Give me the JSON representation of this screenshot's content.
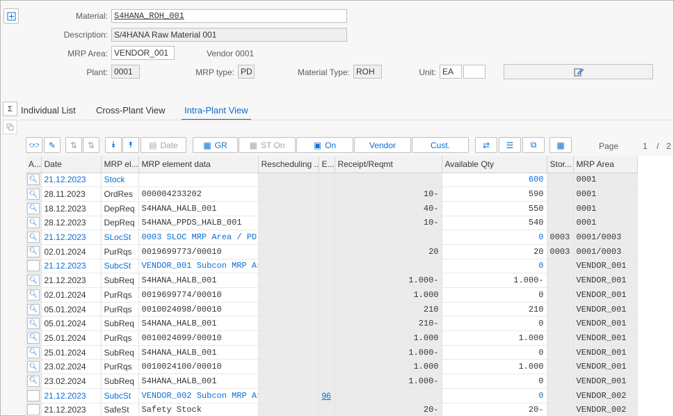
{
  "header": {
    "material_label": "Material:",
    "material_value": "S4HANA_ROH_001",
    "description_label": "Description:",
    "description_value": "S/4HANA Raw Material 001",
    "mrp_area_label": "MRP Area:",
    "mrp_area_value": "VENDOR_001",
    "vendor_text": "Vendor 0001",
    "plant_label": "Plant:",
    "plant_value": "0001",
    "mrp_type_label": "MRP type:",
    "mrp_type_value": "PD",
    "material_type_label": "Material Type:",
    "material_type_value": "ROH",
    "unit_label": "Unit:",
    "unit_value": "EA",
    "unit_extra_value": ""
  },
  "tabs": [
    {
      "label": "Individual List"
    },
    {
      "label": "Cross-Plant View"
    },
    {
      "label": "Intra-Plant View"
    }
  ],
  "side": {
    "sigma": "Σ"
  },
  "toolbar": {
    "date_label": "Date",
    "gr_label": "GR",
    "st_on_label": "ST On",
    "on_label": "On",
    "vendor_label": "Vendor",
    "cust_label": "Cust.",
    "page_label": "Page",
    "page_current": "1",
    "page_sep": "/",
    "page_total": "2"
  },
  "colors": {
    "accent": "#0a6ed1",
    "header_bg": "#f7f7f7",
    "cell_grey": "#ebebeb"
  },
  "table": {
    "columns": [
      "A...",
      "Date",
      "MRP el...",
      "MRP element data",
      "Rescheduling ...",
      "E...",
      "Receipt/Reqmt",
      "Available Qty",
      "Stor...",
      "MRP Area"
    ],
    "rows": [
      {
        "zoom": true,
        "date": "21.12.2023",
        "mrp_el": "Stock",
        "data": "",
        "resched": "",
        "e": "",
        "receipt": "",
        "avail": "600",
        "stor": "",
        "area": "0001",
        "blue": true
      },
      {
        "zoom": true,
        "date": "28.11.2023",
        "mrp_el": "OrdRes",
        "data": "000004233202",
        "resched": "",
        "e": "",
        "receipt": "10-",
        "avail": "590",
        "stor": "",
        "area": "0001",
        "blue": false
      },
      {
        "zoom": true,
        "date": "18.12.2023",
        "mrp_el": "DepReq",
        "data": "S4HANA_HALB_001",
        "resched": "",
        "e": "",
        "receipt": "40-",
        "avail": "550",
        "stor": "",
        "area": "0001",
        "blue": false
      },
      {
        "zoom": true,
        "date": "28.12.2023",
        "mrp_el": "DepReq",
        "data": "S4HANA_PPDS_HALB_001",
        "resched": "",
        "e": "",
        "receipt": "10-",
        "avail": "540",
        "stor": "",
        "area": "0001",
        "blue": false
      },
      {
        "zoom": true,
        "date": "21.12.2023",
        "mrp_el": "SLocSt",
        "data": "0003 SLOC MRP Area / PD",
        "resched": "",
        "e": "",
        "receipt": "",
        "avail": "0",
        "stor": "0003",
        "area": "0001/0003",
        "blue": true
      },
      {
        "zoom": true,
        "date": "02.01.2024",
        "mrp_el": "PurRqs",
        "data": "0019699773/00010",
        "resched": "",
        "e": "",
        "receipt": "20",
        "avail": "20",
        "stor": "0003",
        "area": "0001/0003",
        "blue": false
      },
      {
        "zoom": false,
        "date": "21.12.2023",
        "mrp_el": "SubcSt",
        "data": "VENDOR_001 Subcon MRP Ar...",
        "resched": "",
        "e": "",
        "receipt": "",
        "avail": "0",
        "stor": "",
        "area": "VENDOR_001",
        "blue": true
      },
      {
        "zoom": true,
        "date": "21.12.2023",
        "mrp_el": "SubReq",
        "data": "S4HANA_HALB_001",
        "resched": "",
        "e": "",
        "receipt": "1.000-",
        "avail": "1.000-",
        "stor": "",
        "area": "VENDOR_001",
        "blue": false
      },
      {
        "zoom": true,
        "date": "02.01.2024",
        "mrp_el": "PurRqs",
        "data": "0019699774/00010",
        "resched": "",
        "e": "",
        "receipt": "1.000",
        "avail": "0",
        "stor": "",
        "area": "VENDOR_001",
        "blue": false
      },
      {
        "zoom": true,
        "date": "05.01.2024",
        "mrp_el": "PurRqs",
        "data": "0010024098/00010",
        "resched": "",
        "e": "",
        "receipt": "210",
        "avail": "210",
        "stor": "",
        "area": "VENDOR_001",
        "blue": false
      },
      {
        "zoom": true,
        "date": "05.01.2024",
        "mrp_el": "SubReq",
        "data": "S4HANA_HALB_001",
        "resched": "",
        "e": "",
        "receipt": "210-",
        "avail": "0",
        "stor": "",
        "area": "VENDOR_001",
        "blue": false
      },
      {
        "zoom": true,
        "date": "25.01.2024",
        "mrp_el": "PurRqs",
        "data": "0010024099/00010",
        "resched": "",
        "e": "",
        "receipt": "1.000",
        "avail": "1.000",
        "stor": "",
        "area": "VENDOR_001",
        "blue": false
      },
      {
        "zoom": true,
        "date": "25.01.2024",
        "mrp_el": "SubReq",
        "data": "S4HANA_HALB_001",
        "resched": "",
        "e": "",
        "receipt": "1.000-",
        "avail": "0",
        "stor": "",
        "area": "VENDOR_001",
        "blue": false
      },
      {
        "zoom": true,
        "date": "23.02.2024",
        "mrp_el": "PurRqs",
        "data": "0010024100/00010",
        "resched": "",
        "e": "",
        "receipt": "1.000",
        "avail": "1.000",
        "stor": "",
        "area": "VENDOR_001",
        "blue": false
      },
      {
        "zoom": true,
        "date": "23.02.2024",
        "mrp_el": "SubReq",
        "data": "S4HANA_HALB_001",
        "resched": "",
        "e": "",
        "receipt": "1.000-",
        "avail": "0",
        "stor": "",
        "area": "VENDOR_001",
        "blue": false
      },
      {
        "zoom": false,
        "date": "21.12.2023",
        "mrp_el": "SubcSt",
        "data": "VENDOR_002 Subcon MRP Ar...",
        "resched": "",
        "e": "96",
        "receipt": "",
        "avail": "0",
        "stor": "",
        "area": "VENDOR_002",
        "blue": true
      },
      {
        "zoom": false,
        "date": "21.12.2023",
        "mrp_el": "SafeSt",
        "data": "Safety Stock",
        "resched": "",
        "e": "",
        "receipt": "20-",
        "avail": "20-",
        "stor": "",
        "area": "VENDOR_002",
        "blue": false
      }
    ]
  }
}
